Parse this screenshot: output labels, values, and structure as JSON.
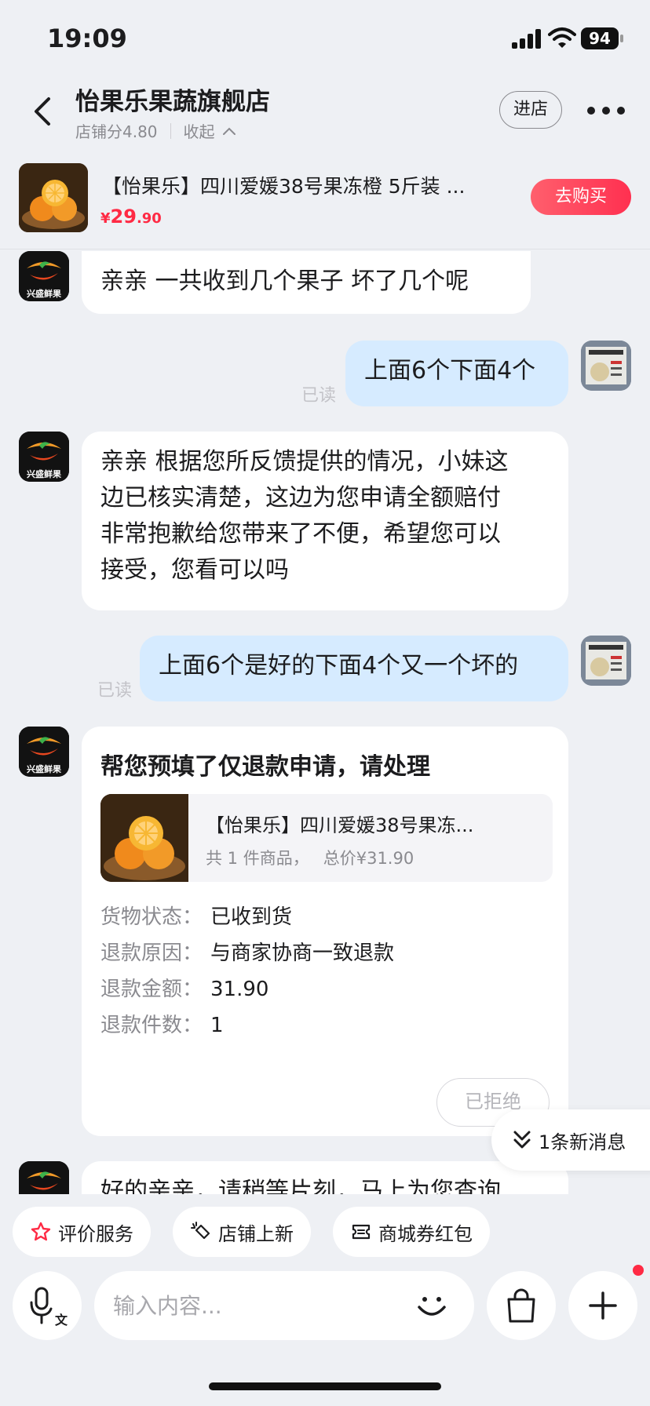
{
  "status_bar": {
    "time": "19:09",
    "battery": "94"
  },
  "header": {
    "shop_name": "怡果乐果蔬旗舰店",
    "shop_score": "店铺分4.80",
    "collapse_label": "收起",
    "enter_shop_label": "进店"
  },
  "product": {
    "title": "【怡果乐】四川爱媛38号果冻橙 5斤装 ...",
    "price_currency": "¥",
    "price_int": "29",
    "price_dec": ".90",
    "buy_label": "去购买"
  },
  "shop_avatar_text": "兴盛鲜果",
  "messages": {
    "m1": "亲亲 一共收到几个果子  坏了几个呢",
    "m2": "上面6个下面4个",
    "m3_l1": "亲亲 根据您所反馈提供的情况，小妹这",
    "m3_l2": "边已核实清楚，这边为您申请全额赔付",
    "m3_l3": "非常抱歉给您带来了不便，希望您可以",
    "m3_l4": "接受，您看可以吗",
    "m4": "上面6个是好的下面4个又一个坏的",
    "m5": "好的亲亲，请稍等片刻，马上为您查询",
    "read_label": "已读"
  },
  "refund_card": {
    "title": "帮您预填了仅退款申请，请处理",
    "product_title": "【怡果乐】四川爱媛38号果冻...",
    "product_count": "共 1 件商品，",
    "product_total": "总价¥31.90",
    "rows": [
      {
        "label": "货物状态：",
        "value": "已收到货"
      },
      {
        "label": "退款原因：",
        "value": "与商家协商一致退款"
      },
      {
        "label": "退款金额：",
        "value": "31.90"
      },
      {
        "label": "退款件数：",
        "value": "1"
      }
    ],
    "status_button": "已拒绝"
  },
  "new_message_label": "1条新消息",
  "quick_actions": [
    "评价服务",
    "店铺上新",
    "商城券红包"
  ],
  "input": {
    "placeholder": "输入内容..."
  },
  "colors": {
    "accent_red": "#ff2a44",
    "user_bubble": "#d6ebff",
    "background": "#eef0f4"
  }
}
